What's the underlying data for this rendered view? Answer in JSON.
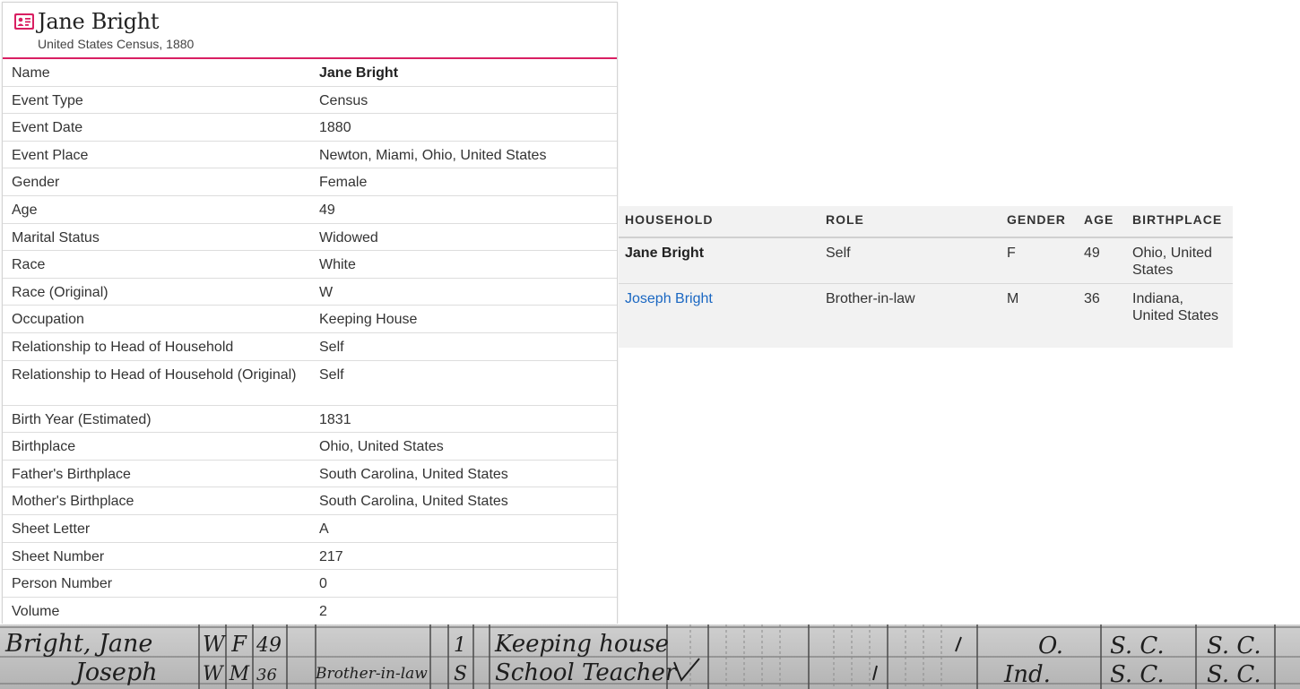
{
  "record": {
    "title": "Jane Bright",
    "subtitle": "United States Census, 1880",
    "icon": "record-card-icon",
    "accent_color": "#d91f62",
    "fields": [
      {
        "label": "Name",
        "value": "Jane Bright"
      },
      {
        "label": "Event Type",
        "value": "Census"
      },
      {
        "label": "Event Date",
        "value": "1880"
      },
      {
        "label": "Event Place",
        "value": "Newton, Miami, Ohio, United States"
      },
      {
        "label": "Gender",
        "value": "Female"
      },
      {
        "label": "Age",
        "value": "49"
      },
      {
        "label": "Marital Status",
        "value": "Widowed"
      },
      {
        "label": "Race",
        "value": "White"
      },
      {
        "label": "Race (Original)",
        "value": "W"
      },
      {
        "label": "Occupation",
        "value": "Keeping House"
      },
      {
        "label": "Relationship to Head of Household",
        "value": "Self"
      },
      {
        "label": "Relationship to Head of Household (Original)",
        "value": "Self"
      },
      {
        "label": "Birth Year (Estimated)",
        "value": "1831"
      },
      {
        "label": "Birthplace",
        "value": "Ohio, United States"
      },
      {
        "label": "Father's Birthplace",
        "value": "South Carolina, United States"
      },
      {
        "label": "Mother's Birthplace",
        "value": "South Carolina, United States"
      },
      {
        "label": "Sheet Letter",
        "value": "A"
      },
      {
        "label": "Sheet Number",
        "value": "217"
      },
      {
        "label": "Person Number",
        "value": "0"
      },
      {
        "label": "Volume",
        "value": "2"
      }
    ]
  },
  "household": {
    "headers": {
      "household": "HOUSEHOLD",
      "role": "ROLE",
      "gender": "GENDER",
      "age": "AGE",
      "birthplace": "BIRTHPLACE"
    },
    "rows": [
      {
        "name": "Jane Bright",
        "role": "Self",
        "gender": "F",
        "age": "49",
        "birthplace": "Ohio, United States"
      },
      {
        "name": "Joseph Bright",
        "role": "Brother-in-law",
        "gender": "M",
        "age": "36",
        "birthplace": "Indiana, United States"
      }
    ],
    "link_color": "#1a67c2"
  },
  "census_image": {
    "lines": [
      {
        "name": "Bright, Jane",
        "race_sex": "W F",
        "age": "49",
        "relation": "",
        "mark": "1",
        "occupation": "Keeping house",
        "birth": "O.",
        "father": "S. C.",
        "mother": "S. C."
      },
      {
        "name": "Joseph",
        "race_sex": "W M",
        "age": "36",
        "relation": "Brother-in-law",
        "mark": "S",
        "occupation": "School Teacher",
        "birth": "Ind.",
        "father": "S. C.",
        "mother": "S. C."
      }
    ]
  }
}
